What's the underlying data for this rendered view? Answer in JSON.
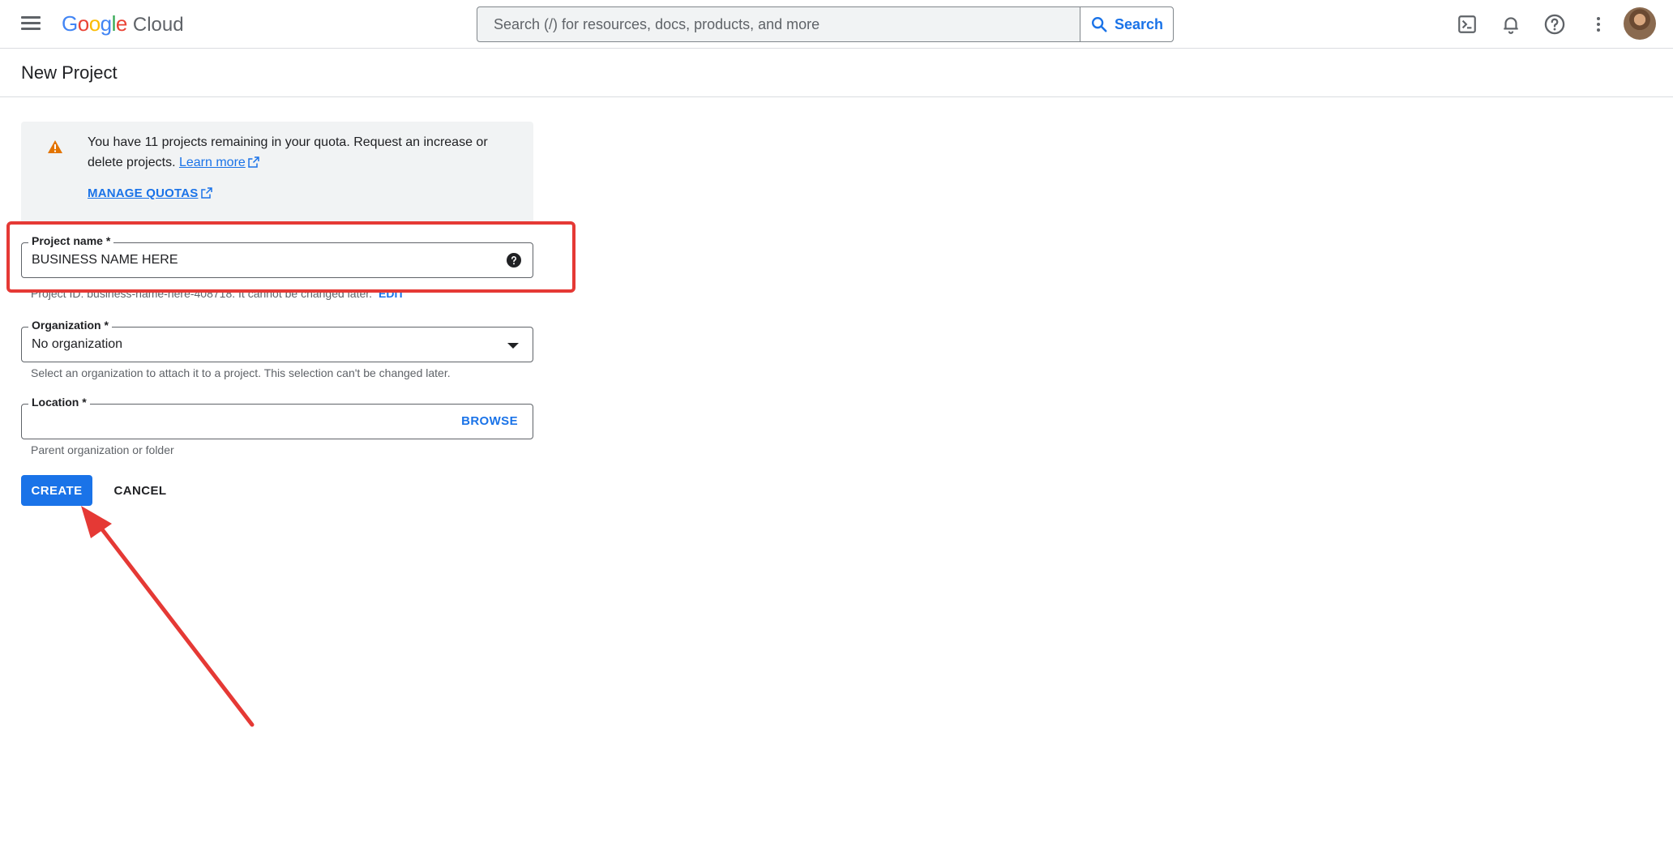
{
  "topbar": {
    "logo_google_letters": [
      "G",
      "o",
      "o",
      "g",
      "l",
      "e"
    ],
    "logo_cloud": "Cloud",
    "search_placeholder": "Search (/) for resources, docs, products, and more",
    "search_button_label": "Search",
    "icons": [
      "menu-icon",
      "terminal-icon",
      "bell-icon",
      "help-circle-icon",
      "more-vert-icon",
      "avatar"
    ]
  },
  "page": {
    "title": "New Project"
  },
  "banner": {
    "text": "You have 11 projects remaining in your quota. Request an increase or delete projects.",
    "learn_more": "Learn more",
    "manage_quotas": "MANAGE QUOTAS"
  },
  "form": {
    "project_name": {
      "label": "Project name *",
      "value": "BUSINESS NAME HERE",
      "hint": "Project ID: business-name-here-408718. It cannot be changed later.",
      "edit": "EDIT"
    },
    "organization": {
      "label": "Organization *",
      "value": "No organization",
      "hint": "Select an organization to attach it to a project. This selection can't be changed later."
    },
    "location": {
      "label": "Location *",
      "value": "",
      "browse": "BROWSE",
      "hint": "Parent organization or folder"
    }
  },
  "actions": {
    "create": "CREATE",
    "cancel": "CANCEL"
  },
  "colors": {
    "accent": "#1a73e8",
    "annotation": "#e53935",
    "warning": "#e37400"
  }
}
